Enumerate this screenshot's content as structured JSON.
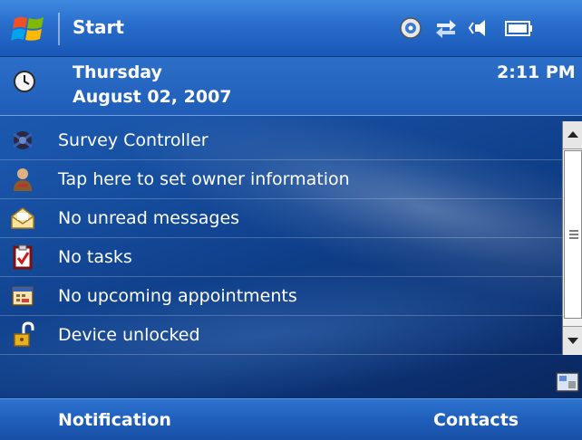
{
  "taskbar": {
    "start_label": "Start",
    "tray_icons": [
      "connectivity-icon",
      "data-connection-icon",
      "volume-icon",
      "battery-icon"
    ]
  },
  "today_header": {
    "day": "Thursday",
    "date": "August 02, 2007",
    "time": "2:11 PM"
  },
  "items": [
    {
      "label": "Survey Controller",
      "icon": "survey-controller-icon"
    },
    {
      "label": "Tap here to set owner information",
      "icon": "owner-icon"
    },
    {
      "label": "No unread messages",
      "icon": "envelope-icon"
    },
    {
      "label": "No tasks",
      "icon": "tasks-icon"
    },
    {
      "label": "No upcoming appointments",
      "icon": "calendar-icon"
    },
    {
      "label": "Device unlocked",
      "icon": "padlock-icon"
    }
  ],
  "softkeys": {
    "left": "Notification",
    "right": "Contacts"
  },
  "colors": {
    "background": "#1a56ab",
    "bar": "#2a6fcd",
    "text": "#ffffff"
  }
}
